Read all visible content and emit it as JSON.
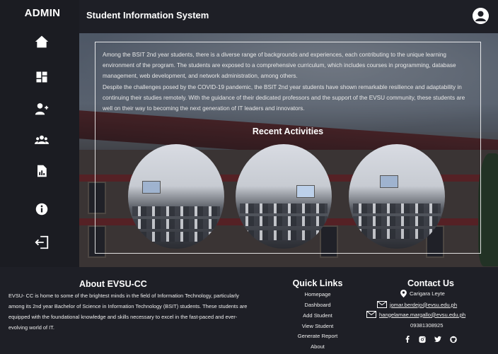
{
  "sidebar": {
    "brand": "ADMIN",
    "items": [
      {
        "icon": "home-icon",
        "label": "Home"
      },
      {
        "icon": "dashboard-icon",
        "label": "Dashboard"
      },
      {
        "icon": "add-user-icon",
        "label": "Add Student"
      },
      {
        "icon": "users-icon",
        "label": "View Student"
      },
      {
        "icon": "report-icon",
        "label": "Generate Report"
      },
      {
        "icon": "info-icon",
        "label": "About"
      },
      {
        "icon": "logout-icon",
        "label": "Logout"
      }
    ]
  },
  "header": {
    "title": "Student Information System",
    "avatar_icon": "account-circle-icon"
  },
  "hero": {
    "paragraph_1": "Among the BSIT 2nd year students, there is a diverse range of backgrounds and experiences, each contributing to the unique learning environment of the program. The students are exposed to a comprehensive curriculum, which includes courses in programming, database management, web development, and network administration, among others.",
    "paragraph_2": "Despite the challenges posed by the COVID-19 pandemic, the BSIT 2nd year students have shown remarkable resilience and adaptability in continuing their studies remotely. With the guidance of their dedicated professors and the support of the EVSU community, these students are well on their way to becoming the next generation of IT leaders and innovators.",
    "activities_title": "Recent Activities"
  },
  "footer": {
    "about": {
      "title": "About EVSU-CC",
      "text": "EVSU- CC is home to some of the brightest minds in the field of Information Technology, particularly among its 2nd year Bachelor of Science in Information Technology (BSIT) students. These students are equipped with the foundational knowledge and skills necessary to excel in the fast-paced and ever-evolving world of IT."
    },
    "quick_links": {
      "title": "Quick Links",
      "items": [
        "Homepage",
        "Dashboard",
        "Add Student",
        "View Student",
        "Generate Report",
        "About"
      ]
    },
    "contact": {
      "title": "Contact Us",
      "location": "Carigara Leyte",
      "email_1": "jomar.berdejo@evsu.edu.ph",
      "email_2": "hangelamae.margallo@evsu.edu.ph",
      "phone": "09381308925",
      "social": [
        "facebook-icon",
        "instagram-icon",
        "twitter-icon",
        "github-icon"
      ]
    }
  },
  "colors": {
    "background": "#1e1f26",
    "sidebar": "#1b1c22",
    "text": "#ffffff"
  }
}
